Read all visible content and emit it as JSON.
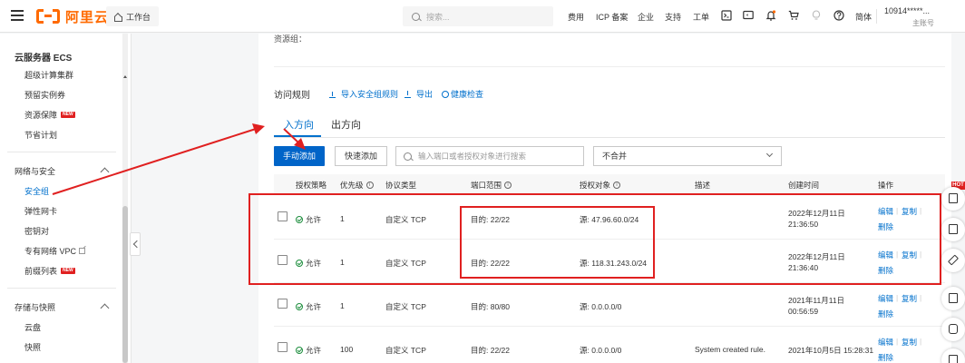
{
  "topbar": {
    "brand": "阿里云",
    "workbench": "工作台",
    "search_placeholder": "搜索...",
    "nav": [
      "费用",
      "ICP 备案",
      "企业",
      "支持",
      "工单"
    ],
    "lang": "简体",
    "user_id": "10914*****...",
    "user_role": "主账号",
    "icons": [
      "menu-icon",
      "home-icon",
      "search-icon",
      "terminal-icon",
      "screen-icon",
      "bell-icon",
      "cart-icon",
      "bulb-icon",
      "help-icon"
    ]
  },
  "sidebar": {
    "title": "云服务器 ECS",
    "top_items": [
      {
        "label": "超级计算集群"
      },
      {
        "label": "预留实例券"
      },
      {
        "label": "资源保障",
        "badge": "NEW"
      },
      {
        "label": "节省计划"
      }
    ],
    "group_network": "网络与安全",
    "network_items": [
      {
        "label": "安全组",
        "active": true
      },
      {
        "label": "弹性网卡"
      },
      {
        "label": "密钥对"
      },
      {
        "label": "专有网络 VPC"
      },
      {
        "label": "前缀列表",
        "badge": "NEW"
      }
    ],
    "group_storage": "存储与快照",
    "storage_items": [
      {
        "label": "云盘"
      },
      {
        "label": "快照"
      }
    ]
  },
  "main": {
    "resource_group_label": "资源组：",
    "rules_title": "访问规则",
    "actions": {
      "import": "导入安全组规则",
      "export": "导出",
      "health": "健康检查"
    },
    "tabs": {
      "inbound": "入方向",
      "outbound": "出方向"
    },
    "toolbar": {
      "manual_add": "手动添加",
      "quick_add": "快速添加",
      "filter_placeholder": "输入端口或者授权对象进行搜索",
      "merge_select": "不合并"
    },
    "columns": {
      "policy": "授权策略",
      "priority": "优先级",
      "protocol": "协议类型",
      "port_range": "端口范围",
      "auth_object": "授权对象",
      "description": "描述",
      "created": "创建时间",
      "ops": "操作"
    },
    "rows": [
      {
        "policy": "允许",
        "priority": "1",
        "protocol": "自定义 TCP",
        "port": "目的: 22/22",
        "source": "源: 47.96.60.0/24",
        "desc": "",
        "created_l1": "2022年12月11日",
        "created_l2": "21:36:50"
      },
      {
        "policy": "允许",
        "priority": "1",
        "protocol": "自定义 TCP",
        "port": "目的: 22/22",
        "source": "源: 118.31.243.0/24",
        "desc": "",
        "created_l1": "2022年12月11日",
        "created_l2": "21:36:40"
      },
      {
        "policy": "允许",
        "priority": "1",
        "protocol": "自定义 TCP",
        "port": "目的: 80/80",
        "source": "源: 0.0.0.0/0",
        "desc": "",
        "created_l1": "2021年11月11日",
        "created_l2": "00:56:59"
      },
      {
        "policy": "允许",
        "priority": "100",
        "protocol": "自定义 TCP",
        "port": "目的: 22/22",
        "source": "源: 0.0.0.0/0",
        "desc": "System created rule.",
        "created_l1": "2021年10月5日 15:28:31",
        "created_l2": ""
      }
    ],
    "row_ops": {
      "edit": "编辑",
      "copy": "复制",
      "delete": "删除"
    }
  },
  "floating": {
    "hot_badge": "HOT"
  },
  "colors": {
    "brand_orange": "#ff6a00",
    "link_blue": "#0070cc",
    "primary_button": "#0064c8",
    "annotation_red": "#e02020",
    "allow_green": "#1e8e3e"
  }
}
